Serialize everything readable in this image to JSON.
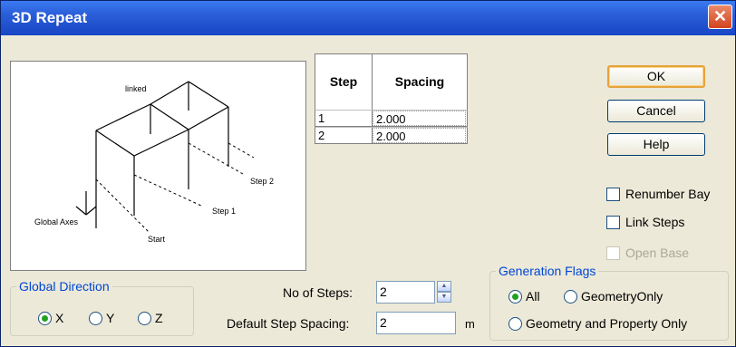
{
  "window": {
    "title": "3D Repeat",
    "close_glyph": "✕"
  },
  "preview": {
    "labels": {
      "linked": "linked",
      "step2": "Step 2",
      "step1": "Step 1",
      "global_axes": "Global Axes",
      "start": "Start"
    }
  },
  "grid": {
    "headers": {
      "step": "Step",
      "spacing": "Spacing"
    },
    "rows": [
      {
        "step": "1",
        "spacing": "2.000"
      },
      {
        "step": "2",
        "spacing": "2.000"
      }
    ]
  },
  "buttons": {
    "ok": "OK",
    "cancel": "Cancel",
    "help": "Help"
  },
  "options": {
    "renumber_bay": {
      "label": "Renumber Bay",
      "checked": false
    },
    "link_steps": {
      "label": "Link Steps",
      "checked": false
    },
    "open_base": {
      "label": "Open Base",
      "checked": false,
      "enabled": false
    }
  },
  "global_direction": {
    "legend": "Global Direction",
    "options": [
      {
        "label": "X",
        "selected": true
      },
      {
        "label": "Y",
        "selected": false
      },
      {
        "label": "Z",
        "selected": false
      }
    ]
  },
  "steps": {
    "no_of_steps_label": "No of Steps:",
    "no_of_steps_value": "2",
    "default_spacing_label": "Default Step Spacing:",
    "default_spacing_value": "2",
    "unit": "m"
  },
  "generation_flags": {
    "legend": "Generation Flags",
    "options": [
      {
        "label": "All",
        "selected": true
      },
      {
        "label": "GeometryOnly",
        "selected": false
      },
      {
        "label": "Geometry and Property Only",
        "selected": false
      }
    ]
  },
  "colors": {
    "title_bar": "#2a5ed8",
    "group_label": "#0046d5",
    "radio_dot": "#21a121",
    "default_button_border": "#e7a339"
  }
}
